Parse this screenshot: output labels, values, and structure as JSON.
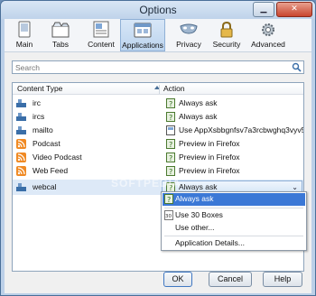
{
  "window": {
    "title": "Options"
  },
  "toolbar": {
    "tabs": [
      {
        "label": "Main",
        "icon": "main-icon"
      },
      {
        "label": "Tabs",
        "icon": "tabs-icon"
      },
      {
        "label": "Content",
        "icon": "content-icon"
      },
      {
        "label": "Applications",
        "icon": "applications-icon",
        "active": true
      },
      {
        "label": "Privacy",
        "icon": "privacy-mask-icon"
      },
      {
        "label": "Security",
        "icon": "security-lock-icon"
      },
      {
        "label": "Advanced",
        "icon": "advanced-gear-icon"
      }
    ]
  },
  "search": {
    "placeholder": "Search"
  },
  "table": {
    "col_content_type": "Content Type",
    "col_action": "Action",
    "rows": [
      {
        "type": "irc",
        "action": "Always ask",
        "type_icon": "protocol-icon",
        "action_icon": "ask-icon"
      },
      {
        "type": "ircs",
        "action": "Always ask",
        "type_icon": "protocol-icon",
        "action_icon": "ask-icon"
      },
      {
        "type": "mailto",
        "action": "Use AppXsbbgnfsv7a3rcbwghq3vyv59...",
        "type_icon": "protocol-icon",
        "action_icon": "app-icon"
      },
      {
        "type": "Podcast",
        "action": "Preview in Firefox",
        "type_icon": "feed-icon",
        "action_icon": "ask-icon"
      },
      {
        "type": "Video Podcast",
        "action": "Preview in Firefox",
        "type_icon": "feed-icon",
        "action_icon": "ask-icon"
      },
      {
        "type": "Web Feed",
        "action": "Preview in Firefox",
        "type_icon": "feed-icon",
        "action_icon": "ask-icon"
      },
      {
        "type": "webcal",
        "action": "Always ask",
        "type_icon": "protocol-icon",
        "action_icon": "ask-icon",
        "selected": true
      }
    ]
  },
  "dropdown": {
    "items": [
      {
        "label": "Always ask",
        "selected": true
      },
      {
        "label": "Use 30 Boxes"
      },
      {
        "label": "Use other..."
      },
      {
        "label": "Application Details..."
      }
    ]
  },
  "buttons": {
    "ok": "OK",
    "cancel": "Cancel",
    "help": "Help"
  },
  "watermark": "SOFTPEDIA",
  "colors": {
    "accent": "#3b78d6",
    "frame": "#bcd0e8"
  }
}
